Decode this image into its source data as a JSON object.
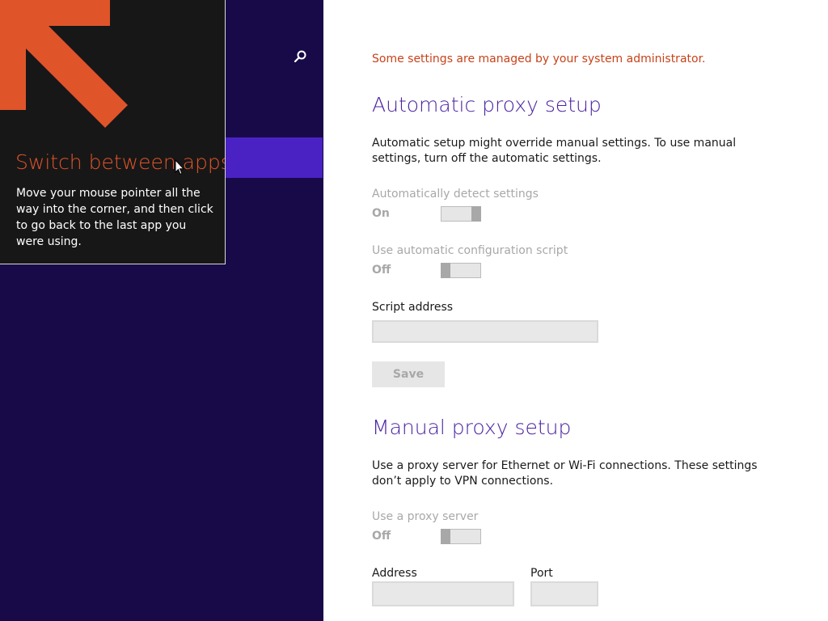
{
  "colors": {
    "nav_background": "#180a48",
    "nav_selected": "#4a22c4",
    "tip_background": "#171717",
    "tip_accent": "#e0542a",
    "heading": "#4a22a0",
    "admin_note": "#c8421a",
    "disabled_text": "#a8a8a8"
  },
  "nav": {
    "search_icon": "search-icon"
  },
  "tip": {
    "arrow_icon": "arrow-up-left-icon",
    "title": "Switch between apps",
    "body": "Move your mouse pointer all the way into the corner, and then click to go back to the last app you were using."
  },
  "content": {
    "admin_note": "Some settings are managed by your system administrator.",
    "automatic": {
      "title": "Automatic proxy setup",
      "description": "Automatic setup might override manual settings. To use manual settings, turn off the automatic settings.",
      "detect": {
        "label": "Automatically detect settings",
        "state": "On",
        "value": true
      },
      "script": {
        "label": "Use automatic configuration script",
        "state": "Off",
        "value": false
      },
      "script_address": {
        "label": "Script address",
        "value": ""
      },
      "save_label": "Save"
    },
    "manual": {
      "title": "Manual proxy setup",
      "description": "Use a proxy server for Ethernet or Wi-Fi connections. These settings don’t apply to VPN connections.",
      "use_proxy": {
        "label": "Use a proxy server",
        "state": "Off",
        "value": false
      },
      "address": {
        "label": "Address",
        "value": ""
      },
      "port": {
        "label": "Port",
        "value": ""
      }
    }
  }
}
